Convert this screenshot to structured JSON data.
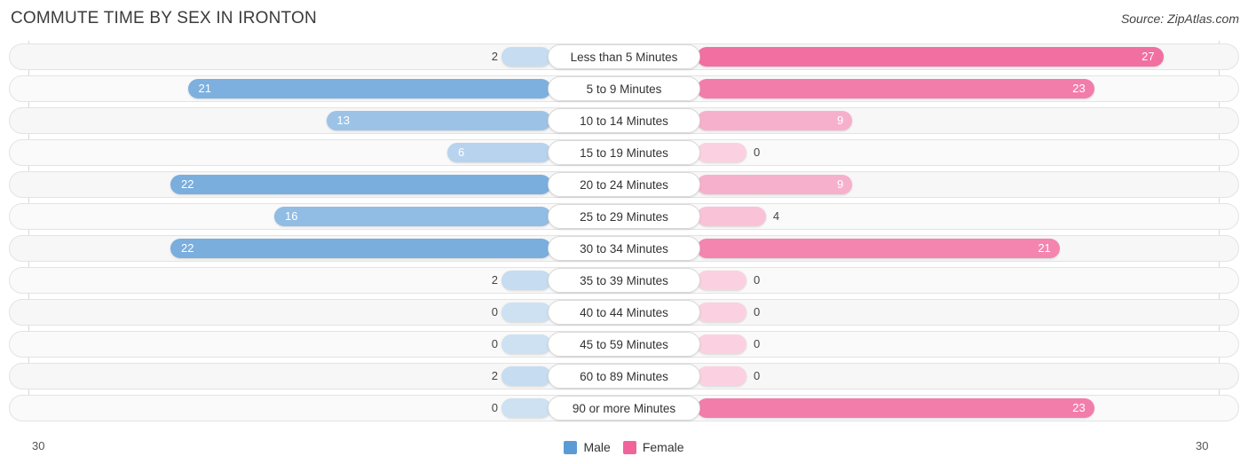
{
  "header": {
    "title": "COMMUTE TIME BY SEX IN IRONTON",
    "source": "Source: ZipAtlas.com"
  },
  "axis": {
    "left_label": "30",
    "right_label": "30"
  },
  "legend": {
    "items": [
      {
        "label": "Male",
        "color": "#5B9BD5"
      },
      {
        "label": "Female",
        "color": "#F0649A"
      }
    ]
  },
  "chart_data": {
    "type": "bar",
    "subtype": "diverging-butterfly",
    "title": "COMMUTE TIME BY SEX IN IRONTON",
    "xlabel": "",
    "ylabel": "",
    "xlim": [
      30,
      30
    ],
    "axis_max": 30,
    "grid": true,
    "legend_position": "bottom-center",
    "categories": [
      "Less than 5 Minutes",
      "5 to 9 Minutes",
      "10 to 14 Minutes",
      "15 to 19 Minutes",
      "20 to 24 Minutes",
      "25 to 29 Minutes",
      "30 to 34 Minutes",
      "35 to 39 Minutes",
      "40 to 44 Minutes",
      "45 to 59 Minutes",
      "60 to 89 Minutes",
      "90 or more Minutes"
    ],
    "series": [
      {
        "name": "Male",
        "side": "left",
        "color": "#5B9BD5",
        "values": [
          2,
          21,
          13,
          6,
          22,
          16,
          22,
          2,
          0,
          0,
          2,
          0
        ],
        "labels": [
          "2",
          "21",
          "13",
          "6",
          "22",
          "16",
          "22",
          "2",
          "0",
          "0",
          "2",
          "0"
        ]
      },
      {
        "name": "Female",
        "side": "right",
        "color": "#F0649A",
        "values": [
          27,
          23,
          9,
          0,
          9,
          4,
          21,
          0,
          0,
          0,
          0,
          23
        ],
        "labels": [
          "27",
          "23",
          "9",
          "0",
          "9",
          "4",
          "21",
          "0",
          "0",
          "0",
          "0",
          "23"
        ]
      }
    ]
  }
}
